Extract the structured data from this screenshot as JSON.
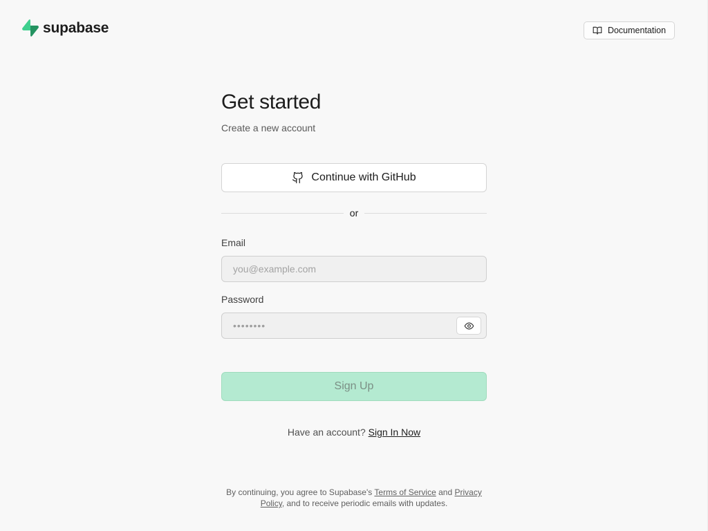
{
  "header": {
    "logo_text": "supabase",
    "logo_icon": "supabase-bolt-icon",
    "docs_label": "Documentation",
    "docs_icon": "book-open-icon"
  },
  "form": {
    "title": "Get started",
    "subtitle": "Create a new account",
    "github_label": "Continue with GitHub",
    "github_icon": "github-icon",
    "divider_text": "or",
    "email_label": "Email",
    "email_placeholder": "you@example.com",
    "email_value": "",
    "password_label": "Password",
    "password_placeholder": "••••••••",
    "password_value": "",
    "password_toggle_icon": "eye-icon",
    "signup_label": "Sign Up"
  },
  "signin": {
    "prompt": "Have an account?",
    "link": "Sign In Now"
  },
  "legal": {
    "prefix": "By continuing, you agree to Supabase's",
    "terms": "Terms of Service",
    "and": "and",
    "privacy": "Privacy Policy",
    "suffix": ", and to receive periodic emails with updates."
  },
  "colors": {
    "brand": "#3ecf8e",
    "background": "#f8f8f8",
    "signup_bg_disabled": "#b4ead1"
  }
}
